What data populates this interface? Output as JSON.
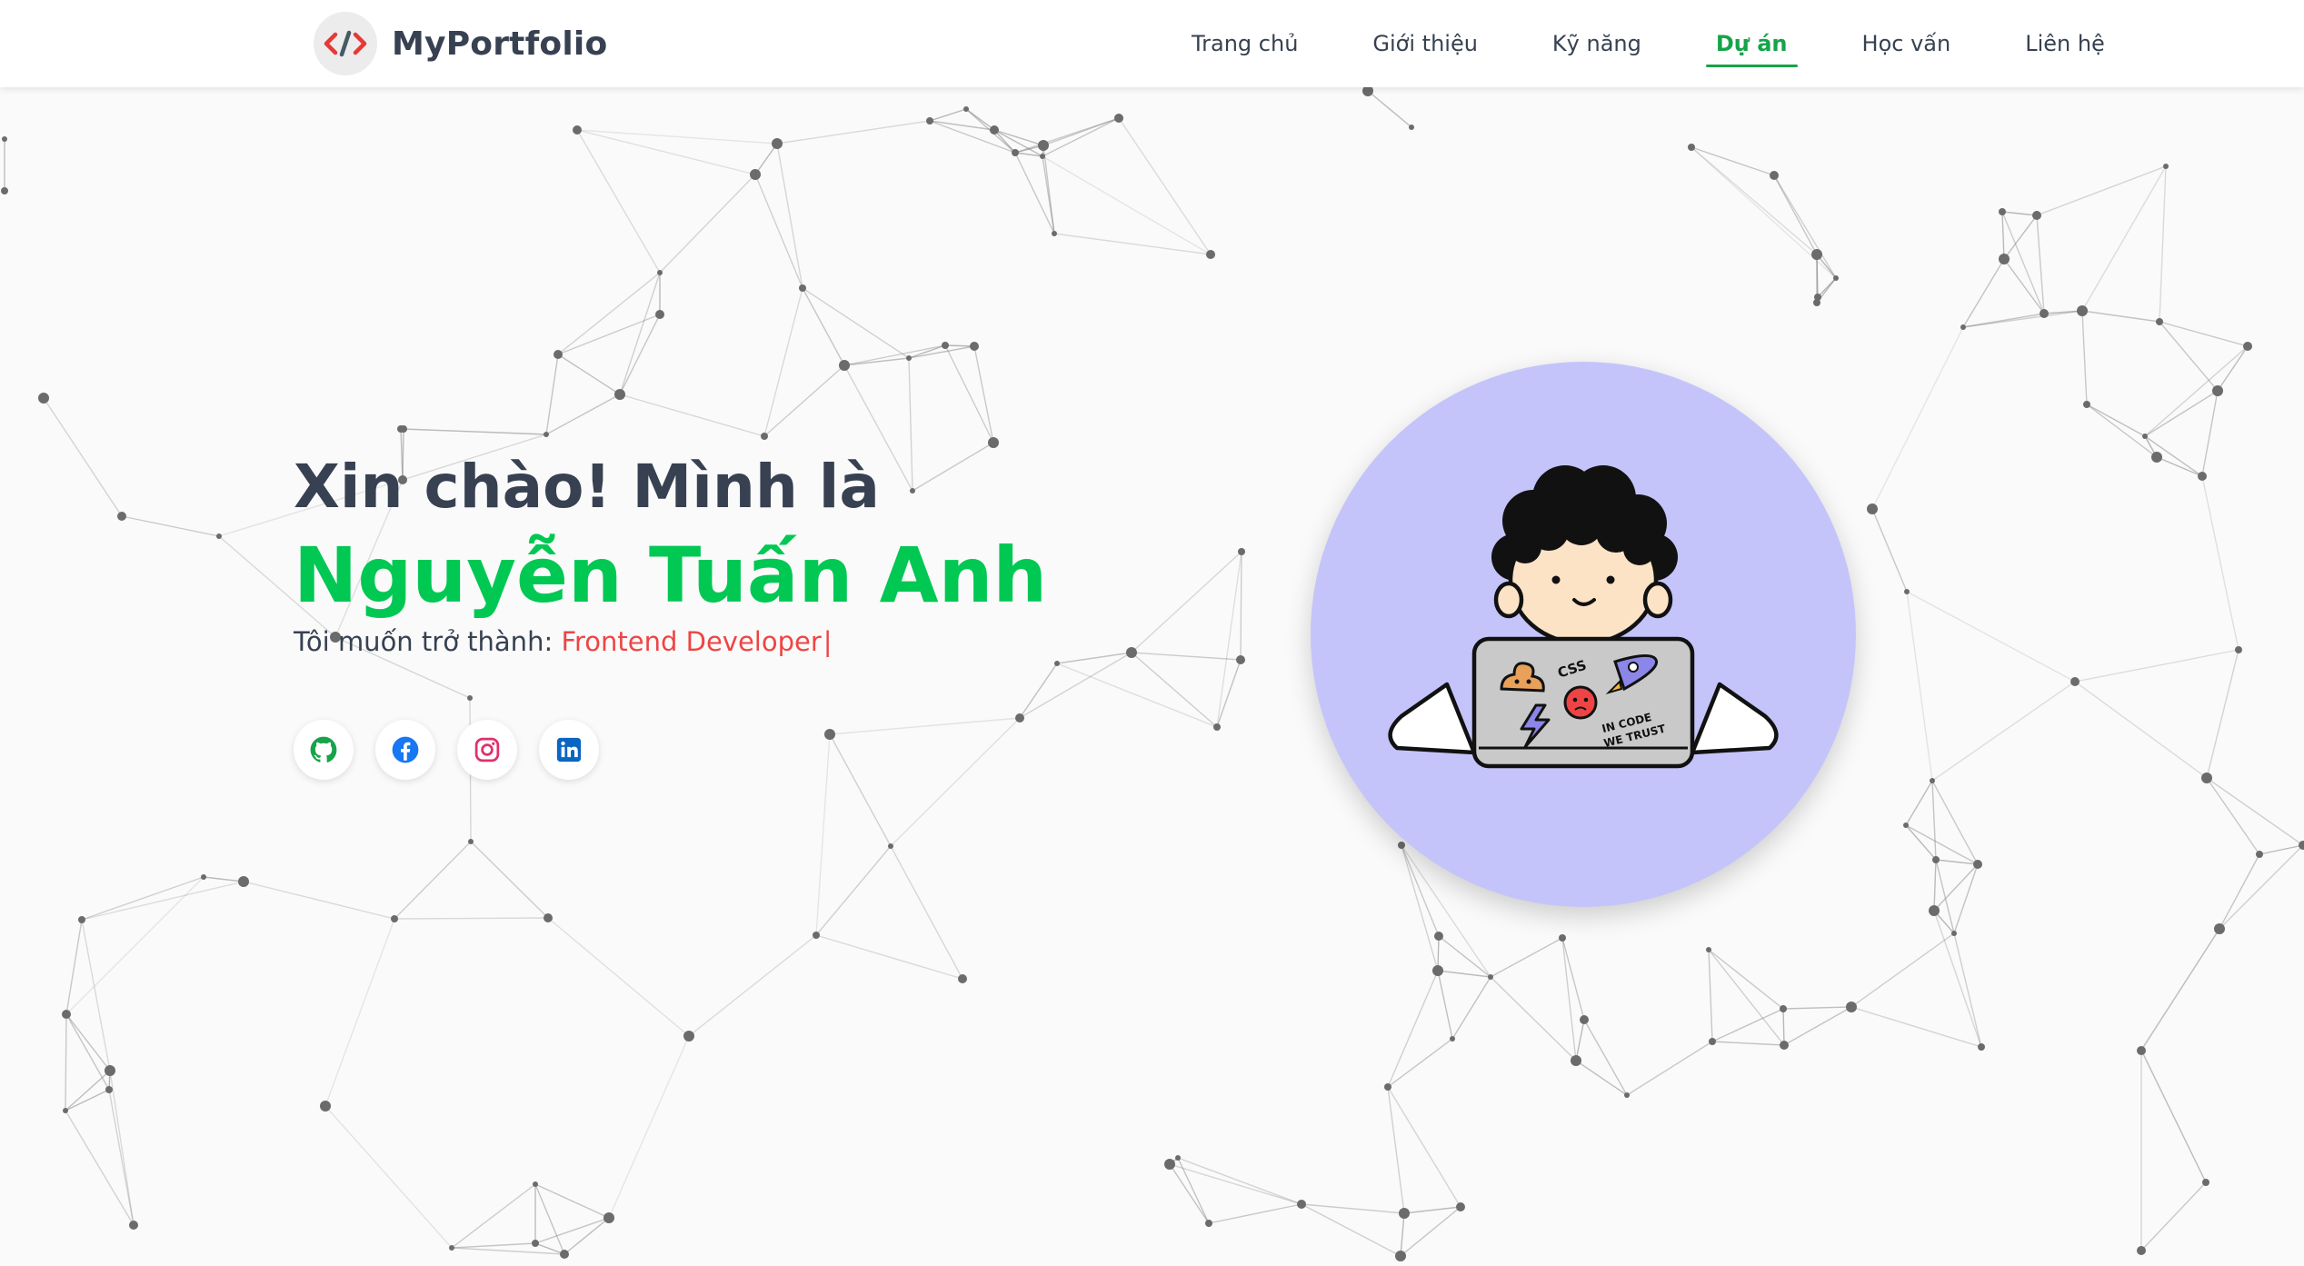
{
  "brand": {
    "logo_text": "</>",
    "name": "MyPortfolio"
  },
  "nav": {
    "items": [
      {
        "label": "Trang chủ",
        "active": false
      },
      {
        "label": "Giới thiệu",
        "active": false
      },
      {
        "label": "Kỹ năng",
        "active": false
      },
      {
        "label": "Dự án",
        "active": true
      },
      {
        "label": "Học vấn",
        "active": false
      },
      {
        "label": "Liên hệ",
        "active": false
      }
    ]
  },
  "hero": {
    "greeting": "Xin chào! Mình là",
    "name": "Nguyễn Tuấn Anh",
    "subtitle_prefix": "Tôi muốn trở thành:",
    "role": "Frontend Developer",
    "caret": "|"
  },
  "socials": [
    {
      "icon": "github-icon",
      "color": "#16a34a"
    },
    {
      "icon": "facebook-icon",
      "color": "#1877f2"
    },
    {
      "icon": "instagram-icon",
      "color": "#e1306c"
    },
    {
      "icon": "linkedin-icon",
      "color": "#0a66c2"
    }
  ],
  "avatar": {
    "laptop_sticker_css": "CSS",
    "laptop_sticker_motto_line1": "IN CODE",
    "laptop_sticker_motto_line2": "WE TRUST"
  },
  "colors": {
    "accent": "#16a34a",
    "name_green": "#00c853",
    "role_red": "#ef4444",
    "avatar_bg": "#c4c4fb",
    "text_dark": "#374151"
  }
}
